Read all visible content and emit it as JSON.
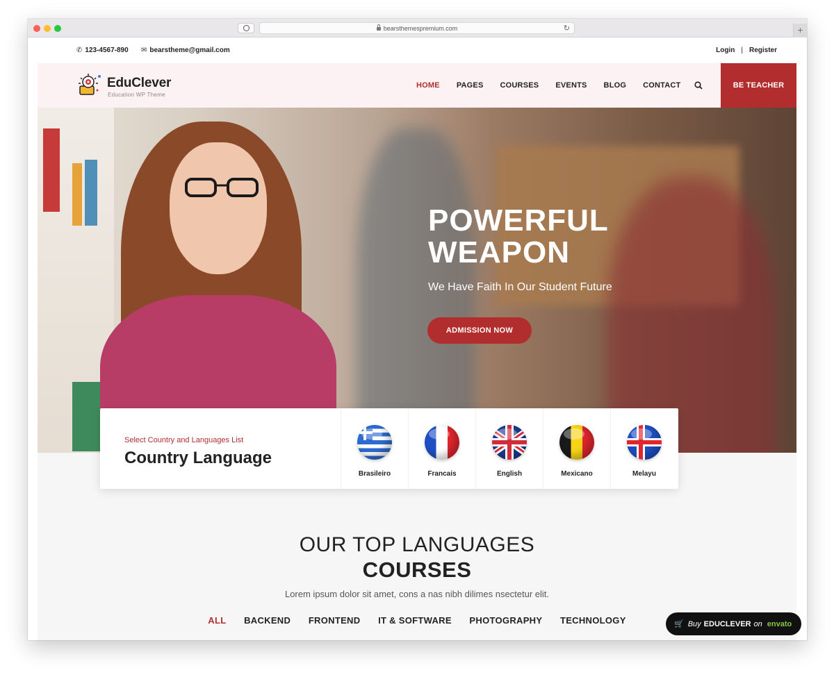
{
  "browser": {
    "url": "bearsthemespremium.com"
  },
  "topbar": {
    "phone": "123-4567-890",
    "email": "bearstheme@gmail.com",
    "login": "Login",
    "separator": "|",
    "register": "Register"
  },
  "header": {
    "logo_name": "EduClever",
    "logo_tagline": "Education WP Theme",
    "nav": [
      "HOME",
      "PAGES",
      "COURSES",
      "EVENTS",
      "BLOG",
      "CONTACT"
    ],
    "active_nav": "HOME",
    "cta": "BE TEACHER"
  },
  "hero": {
    "title_line1": "POWERFUL",
    "title_line2": "WEAPON",
    "subtitle": "We Have Faith In Our Student Future",
    "button": "ADMISSION NOW"
  },
  "languages": {
    "kicker": "Select Country and Languages List",
    "title": "Country Language",
    "items": [
      {
        "label": "Brasileiro",
        "flag": "greece-flag-icon"
      },
      {
        "label": "Francais",
        "flag": "france-flag-icon"
      },
      {
        "label": "English",
        "flag": "uk-flag-icon"
      },
      {
        "label": "Mexicano",
        "flag": "belgium-flag-icon"
      },
      {
        "label": "Melayu",
        "flag": "iceland-flag-icon"
      }
    ]
  },
  "courses": {
    "title_line1": "OUR TOP LANGUAGES",
    "title_line2": "COURSES",
    "description": "Lorem ipsum dolor sit amet, cons a nas nibh dilimes nsectetur elit.",
    "filters": [
      "ALL",
      "BACKEND",
      "FRONTEND",
      "IT & SOFTWARE",
      "PHOTOGRAPHY",
      "TECHNOLOGY"
    ],
    "active_filter": "ALL"
  },
  "badge": {
    "buy": "Buy",
    "brand": "EDUCLEVER",
    "on": "on",
    "market": "envato"
  },
  "colors": {
    "accent": "#b22d2d",
    "header_bg": "#fcf1f3"
  }
}
